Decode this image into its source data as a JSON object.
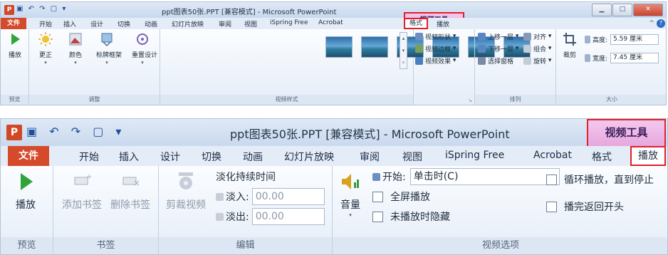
{
  "colors": {
    "file_tab": "#d54a2a",
    "context_tab": "#e6a8dd",
    "highlight_border": "#e0202a",
    "ribbon_bg": "#eef3fa"
  },
  "screen1": {
    "title": "ppt图表50张.PPT [兼容模式] - Microsoft PowerPoint",
    "context_label": "视频工具",
    "tabs": [
      "文件",
      "开始",
      "插入",
      "设计",
      "切换",
      "动画",
      "幻灯片放映",
      "审阅",
      "视图",
      "iSpring Free",
      "Acrobat",
      "格式",
      "播放"
    ],
    "groups": {
      "preview": {
        "label": "预览",
        "play": "播放"
      },
      "adjust": {
        "label": "调整",
        "buttons": [
          "更正",
          "颜色",
          "标牌框架",
          "重置设计"
        ]
      },
      "video_styles": {
        "label": "视频样式",
        "side": [
          "视频形状",
          "视频边框",
          "视频效果"
        ]
      },
      "arrange": {
        "label": "排列",
        "items": [
          "上移一层",
          "下移一层",
          "选择窗格",
          "对齐",
          "组合",
          "旋转"
        ]
      },
      "size": {
        "label": "大小",
        "crop": "裁剪",
        "height_label": "高度:",
        "height_value": "5.59 厘米",
        "width_label": "宽度:",
        "width_value": "7.45 厘米"
      }
    }
  },
  "screen2": {
    "title": "ppt图表50张.PPT [兼容模式] - Microsoft PowerPoint",
    "context_label": "视频工具",
    "tabs": [
      "文件",
      "开始",
      "插入",
      "设计",
      "切换",
      "动画",
      "幻灯片放映",
      "审阅",
      "视图",
      "iSpring Free",
      "Acrobat",
      "格式",
      "播放"
    ],
    "groups": {
      "preview": {
        "label": "预览",
        "play": "播放"
      },
      "bookmarks": {
        "label": "书签",
        "add": "添加书签",
        "remove": "删除书签"
      },
      "edit": {
        "label": "编辑",
        "trim": "剪裁视频",
        "fade_title": "淡化持续时间",
        "fade_in_label": "淡入:",
        "fade_in_value": "00.00",
        "fade_out_label": "淡出:",
        "fade_out_value": "00.00"
      },
      "options": {
        "label": "视频选项",
        "volume": "音量",
        "start_label": "开始:",
        "start_value": "单击时(C)",
        "fullscreen": "全屏播放",
        "hide": "未播放时隐藏",
        "loop": "循环播放，直到停止",
        "rewind": "播完返回开头"
      }
    }
  }
}
